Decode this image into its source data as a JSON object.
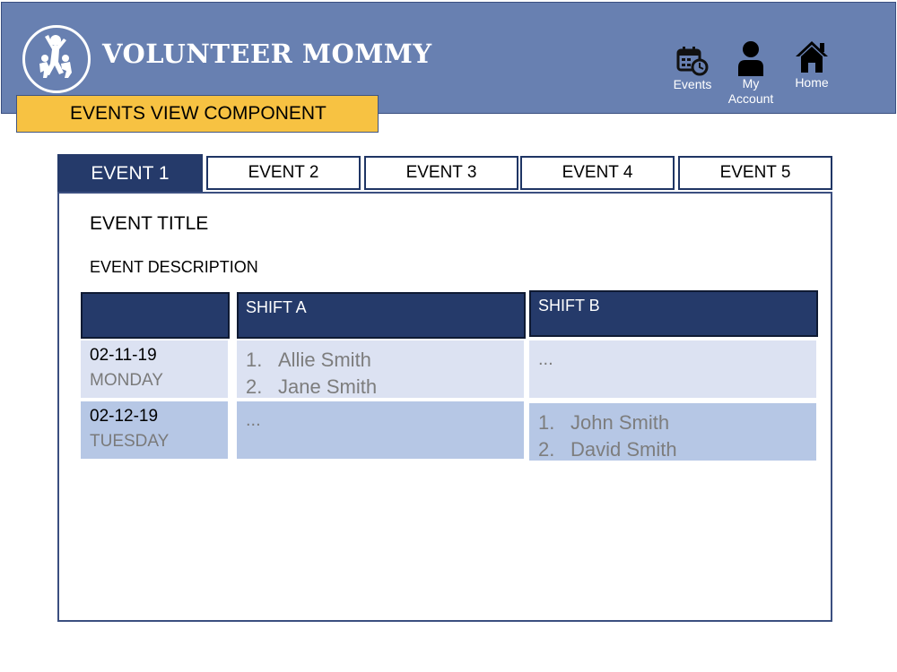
{
  "app": {
    "brand": "VOLUNTEER MOMMY",
    "component_label": "EVENTS VIEW COMPONENT"
  },
  "nav": {
    "events": "Events",
    "my_account_line1": "My",
    "my_account_line2": "Account",
    "home": "Home"
  },
  "tabs": [
    {
      "label": "EVENT 1",
      "active": true
    },
    {
      "label": "EVENT 2",
      "active": false
    },
    {
      "label": "EVENT 3",
      "active": false
    },
    {
      "label": "EVENT 4",
      "active": false
    },
    {
      "label": "EVENT 5",
      "active": false
    }
  ],
  "event": {
    "title": "EVENT TITLE",
    "description": "EVENT DESCRIPTION"
  },
  "schedule": {
    "headers": [
      "",
      "SHIFT A",
      "SHIFT B"
    ],
    "rows": [
      {
        "date": "02-11-19",
        "day": "MONDAY",
        "shift_a": [
          {
            "num": "1.",
            "name": "Allie Smith"
          },
          {
            "num": "2.",
            "name": "Jane Smith"
          }
        ],
        "shift_b": "..."
      },
      {
        "date": "02-12-19",
        "day": "TUESDAY",
        "shift_a": "...",
        "shift_b": [
          {
            "num": "1.",
            "name": "John Smith"
          },
          {
            "num": "2.",
            "name": "David Smith"
          }
        ]
      }
    ]
  },
  "colors": {
    "header_bg": "#6880b1",
    "label_bg": "#f7c242",
    "navy": "#253a6a",
    "row_light": "#dce2f2",
    "row_medium": "#b6c7e5"
  },
  "icons": [
    "logo-icon",
    "calendar-clock-icon",
    "person-icon",
    "home-icon"
  ]
}
